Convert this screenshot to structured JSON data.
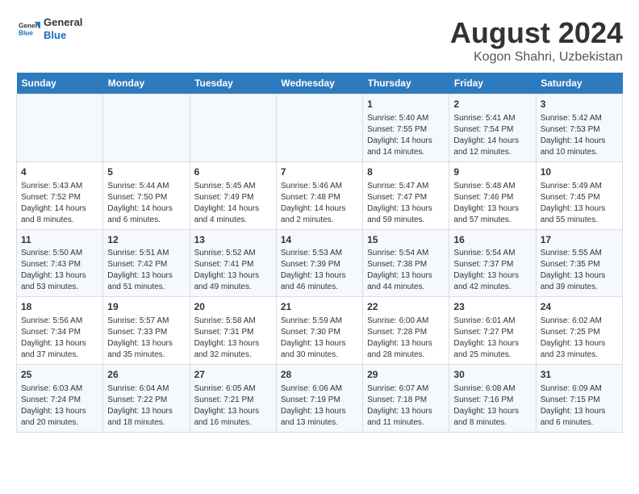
{
  "header": {
    "logo": {
      "general": "General",
      "blue": "Blue"
    },
    "title": "August 2024",
    "subtitle": "Kogon Shahri, Uzbekistan"
  },
  "days_of_week": [
    "Sunday",
    "Monday",
    "Tuesday",
    "Wednesday",
    "Thursday",
    "Friday",
    "Saturday"
  ],
  "weeks": [
    [
      {
        "day": "",
        "info": ""
      },
      {
        "day": "",
        "info": ""
      },
      {
        "day": "",
        "info": ""
      },
      {
        "day": "",
        "info": ""
      },
      {
        "day": "1",
        "info": "Sunrise: 5:40 AM\nSunset: 7:55 PM\nDaylight: 14 hours and 14 minutes."
      },
      {
        "day": "2",
        "info": "Sunrise: 5:41 AM\nSunset: 7:54 PM\nDaylight: 14 hours and 12 minutes."
      },
      {
        "day": "3",
        "info": "Sunrise: 5:42 AM\nSunset: 7:53 PM\nDaylight: 14 hours and 10 minutes."
      }
    ],
    [
      {
        "day": "4",
        "info": "Sunrise: 5:43 AM\nSunset: 7:52 PM\nDaylight: 14 hours and 8 minutes."
      },
      {
        "day": "5",
        "info": "Sunrise: 5:44 AM\nSunset: 7:50 PM\nDaylight: 14 hours and 6 minutes."
      },
      {
        "day": "6",
        "info": "Sunrise: 5:45 AM\nSunset: 7:49 PM\nDaylight: 14 hours and 4 minutes."
      },
      {
        "day": "7",
        "info": "Sunrise: 5:46 AM\nSunset: 7:48 PM\nDaylight: 14 hours and 2 minutes."
      },
      {
        "day": "8",
        "info": "Sunrise: 5:47 AM\nSunset: 7:47 PM\nDaylight: 13 hours and 59 minutes."
      },
      {
        "day": "9",
        "info": "Sunrise: 5:48 AM\nSunset: 7:46 PM\nDaylight: 13 hours and 57 minutes."
      },
      {
        "day": "10",
        "info": "Sunrise: 5:49 AM\nSunset: 7:45 PM\nDaylight: 13 hours and 55 minutes."
      }
    ],
    [
      {
        "day": "11",
        "info": "Sunrise: 5:50 AM\nSunset: 7:43 PM\nDaylight: 13 hours and 53 minutes."
      },
      {
        "day": "12",
        "info": "Sunrise: 5:51 AM\nSunset: 7:42 PM\nDaylight: 13 hours and 51 minutes."
      },
      {
        "day": "13",
        "info": "Sunrise: 5:52 AM\nSunset: 7:41 PM\nDaylight: 13 hours and 49 minutes."
      },
      {
        "day": "14",
        "info": "Sunrise: 5:53 AM\nSunset: 7:39 PM\nDaylight: 13 hours and 46 minutes."
      },
      {
        "day": "15",
        "info": "Sunrise: 5:54 AM\nSunset: 7:38 PM\nDaylight: 13 hours and 44 minutes."
      },
      {
        "day": "16",
        "info": "Sunrise: 5:54 AM\nSunset: 7:37 PM\nDaylight: 13 hours and 42 minutes."
      },
      {
        "day": "17",
        "info": "Sunrise: 5:55 AM\nSunset: 7:35 PM\nDaylight: 13 hours and 39 minutes."
      }
    ],
    [
      {
        "day": "18",
        "info": "Sunrise: 5:56 AM\nSunset: 7:34 PM\nDaylight: 13 hours and 37 minutes."
      },
      {
        "day": "19",
        "info": "Sunrise: 5:57 AM\nSunset: 7:33 PM\nDaylight: 13 hours and 35 minutes."
      },
      {
        "day": "20",
        "info": "Sunrise: 5:58 AM\nSunset: 7:31 PM\nDaylight: 13 hours and 32 minutes."
      },
      {
        "day": "21",
        "info": "Sunrise: 5:59 AM\nSunset: 7:30 PM\nDaylight: 13 hours and 30 minutes."
      },
      {
        "day": "22",
        "info": "Sunrise: 6:00 AM\nSunset: 7:28 PM\nDaylight: 13 hours and 28 minutes."
      },
      {
        "day": "23",
        "info": "Sunrise: 6:01 AM\nSunset: 7:27 PM\nDaylight: 13 hours and 25 minutes."
      },
      {
        "day": "24",
        "info": "Sunrise: 6:02 AM\nSunset: 7:25 PM\nDaylight: 13 hours and 23 minutes."
      }
    ],
    [
      {
        "day": "25",
        "info": "Sunrise: 6:03 AM\nSunset: 7:24 PM\nDaylight: 13 hours and 20 minutes."
      },
      {
        "day": "26",
        "info": "Sunrise: 6:04 AM\nSunset: 7:22 PM\nDaylight: 13 hours and 18 minutes."
      },
      {
        "day": "27",
        "info": "Sunrise: 6:05 AM\nSunset: 7:21 PM\nDaylight: 13 hours and 16 minutes."
      },
      {
        "day": "28",
        "info": "Sunrise: 6:06 AM\nSunset: 7:19 PM\nDaylight: 13 hours and 13 minutes."
      },
      {
        "day": "29",
        "info": "Sunrise: 6:07 AM\nSunset: 7:18 PM\nDaylight: 13 hours and 11 minutes."
      },
      {
        "day": "30",
        "info": "Sunrise: 6:08 AM\nSunset: 7:16 PM\nDaylight: 13 hours and 8 minutes."
      },
      {
        "day": "31",
        "info": "Sunrise: 6:09 AM\nSunset: 7:15 PM\nDaylight: 13 hours and 6 minutes."
      }
    ]
  ]
}
